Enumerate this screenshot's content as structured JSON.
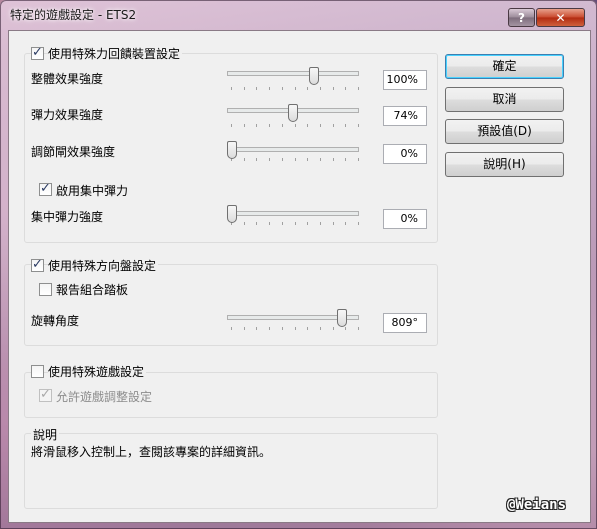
{
  "window": {
    "title": "特定的遊戲設定 - ETS2",
    "help_glyph": "?",
    "close_glyph": "✕"
  },
  "force_feedback": {
    "enable_label": "使用特殊力回饋裝置設定",
    "enabled": true,
    "sliders": [
      {
        "label": "整體效果強度",
        "value_text": "100%",
        "value": 0.6
      },
      {
        "label": "彈力效果強度",
        "value_text": "74%",
        "value": 0.45
      },
      {
        "label": "調節閘效果強度",
        "value_text": "0%",
        "value": 0.0
      }
    ],
    "centering": {
      "enable_label": "啟用集中彈力",
      "enabled": true,
      "slider": {
        "label": "集中彈力強度",
        "value_text": "0%",
        "value": 0.0
      }
    }
  },
  "wheel": {
    "enable_label": "使用特殊方向盤設定",
    "enabled": true,
    "combined_pedals_label": "報告組合踏板",
    "combined_pedals": false,
    "rotation": {
      "label": "旋轉角度",
      "value_text": "809°",
      "value": 0.88
    }
  },
  "game": {
    "enable_label": "使用特殊遊戲設定",
    "enabled": false,
    "allow_adjust_label": "允許遊戲調整設定",
    "allow_adjust": true
  },
  "buttons": {
    "ok": "確定",
    "cancel": "取消",
    "defaults": "預設值(D)",
    "help": "說明(H)"
  },
  "description": {
    "legend": "說明",
    "text": "將滑鼠移入控制上，查閱該專案的詳細資訊。"
  },
  "watermark": "@Weians"
}
